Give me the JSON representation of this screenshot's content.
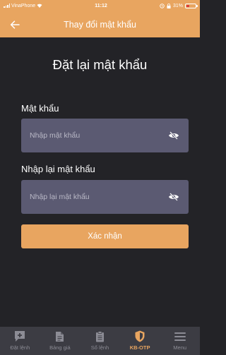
{
  "status_bar": {
    "carrier": "VinaPhone",
    "time": "11:12",
    "battery": "31%"
  },
  "header": {
    "title": "Thay đổi mật khẩu"
  },
  "form": {
    "title": "Đặt lại mật khẩu",
    "password_label": "Mật khẩu",
    "password_placeholder": "Nhập mật khẩu",
    "confirm_label": "Nhập lại mật khẩu",
    "confirm_placeholder": "Nhập lại mật khẩu",
    "submit_label": "Xác nhận"
  },
  "tabbar": {
    "items": [
      {
        "label": "Đặt lệnh",
        "icon": "add-order-icon"
      },
      {
        "label": "Bảng giá",
        "icon": "document-icon"
      },
      {
        "label": "Sổ lệnh",
        "icon": "clipboard-icon"
      },
      {
        "label": "KB-OTP",
        "icon": "shield-icon",
        "active": true
      },
      {
        "label": "Menu",
        "icon": "menu-icon"
      }
    ]
  },
  "colors": {
    "accent": "#e8a560",
    "background": "#232327",
    "input": "#5b5a72",
    "tabbar": "#3c3c43"
  }
}
